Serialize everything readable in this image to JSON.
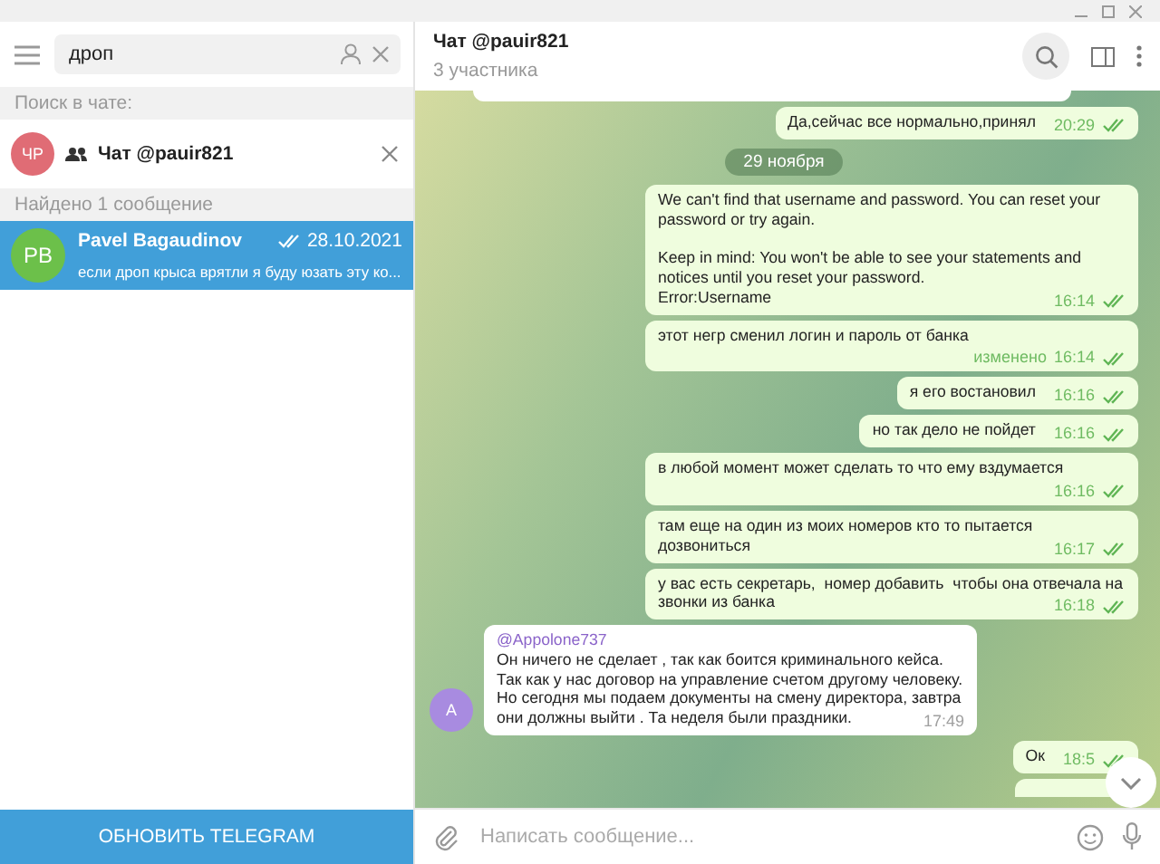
{
  "sidebar": {
    "search": {
      "value": "дроп"
    },
    "search_in_chat_label": "Поиск в чате:",
    "chat_filter": {
      "initials": "ЧР",
      "color": "#e06c75",
      "name": "Чат @pauir821"
    },
    "found_label": "Найдено 1 сообщение",
    "results": [
      {
        "initials": "PB",
        "color": "#6cc04a",
        "name": "Pavel Bagaudinov",
        "date": "28.10.2021",
        "read": true,
        "preview": "если дроп крыса врятли я буду юзать эту ко...",
        "selected": true
      }
    ],
    "update_button": "ОБНОВИТЬ TELEGRAM"
  },
  "chat": {
    "title": "Чат @pauir821",
    "subtitle": "3 участника",
    "messages": [
      {
        "kind": "partial_in"
      },
      {
        "kind": "out",
        "text": "Да,сейчас все нормально,принял",
        "time": "20:29",
        "read": true
      },
      {
        "kind": "date",
        "text": "29 ноября"
      },
      {
        "kind": "out",
        "text": "We can't find that username and password. You can reset your password or try again.\n\nKeep in mind: You won't be able to see your statements and notices until you reset your password.\nError:Username",
        "time": "16:14",
        "read": true
      },
      {
        "kind": "out",
        "text": "этот негр сменил логин и пароль от банка",
        "edited": "изменено",
        "time": "16:14",
        "read": true
      },
      {
        "kind": "out",
        "text": "я его востановил",
        "time": "16:16",
        "read": true
      },
      {
        "kind": "out",
        "text": "но так дело не пойдет",
        "time": "16:16",
        "read": true
      },
      {
        "kind": "out",
        "text": "в любой момент может сделать то что ему вздумается",
        "time": "16:16",
        "read": true
      },
      {
        "kind": "out",
        "text": "там еще на один из моих номеров кто то пытается дозвониться",
        "time": "16:17",
        "read": true
      },
      {
        "kind": "out",
        "text": "у вас есть секретарь,  номер добавить  чтобы она отвечала на звонки из банка",
        "time": "16:18",
        "read": true
      },
      {
        "kind": "in",
        "author": "@Appolone737",
        "initials": "A",
        "color": "#a88be0",
        "text": "Он ничего не сделает , так как боится криминального кейса. Так как у нас договор на управление счетом другому человеку. Но сегодня мы подаем документы на смену директора, завтра они должны выйти . Та неделя были праздники.",
        "time": "17:49"
      },
      {
        "kind": "out",
        "text": "Ок",
        "time": "18:5",
        "read": true
      },
      {
        "kind": "partial_out"
      }
    ],
    "composer": {
      "placeholder": "Написать сообщение..."
    }
  }
}
